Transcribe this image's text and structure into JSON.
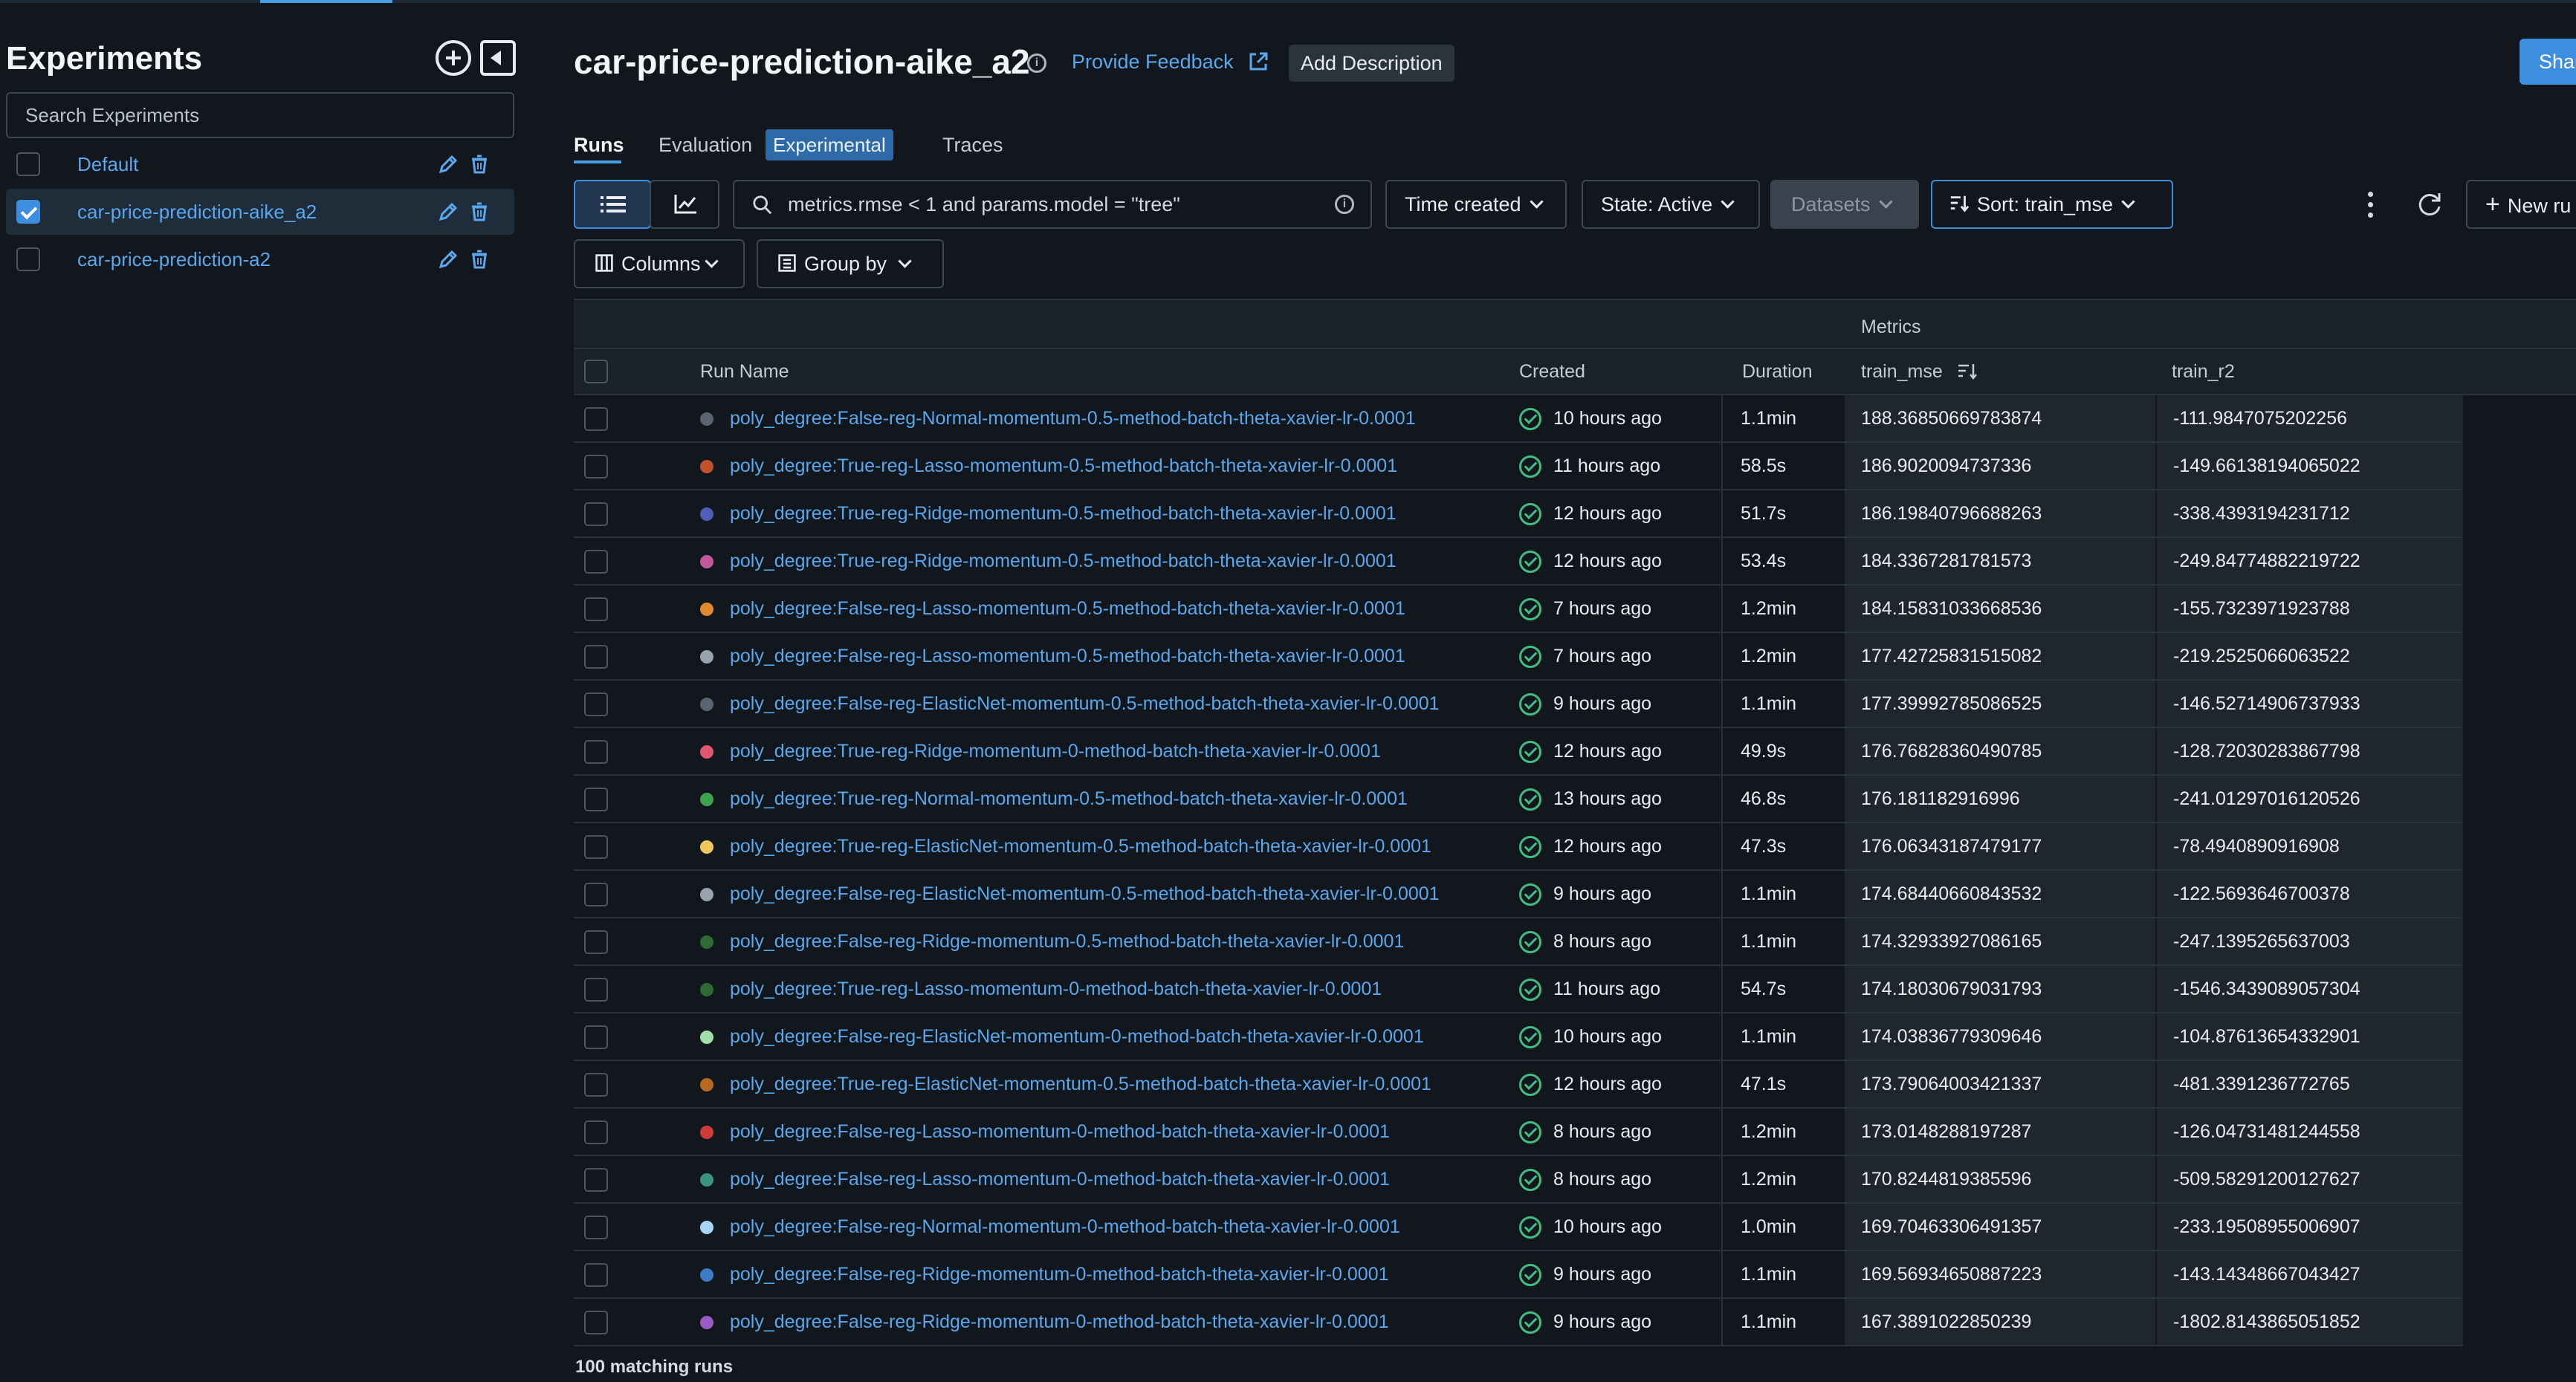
{
  "sidebar": {
    "title": "Experiments",
    "search_placeholder": "Search Experiments",
    "experiments": [
      {
        "name": "Default",
        "checked": false
      },
      {
        "name": "car-price-prediction-aike_a2",
        "checked": true
      },
      {
        "name": "car-price-prediction-a2",
        "checked": false
      }
    ]
  },
  "header": {
    "title": "car-price-prediction-aike_a2",
    "feedback_label": "Provide Feedback",
    "add_description_label": "Add Description",
    "share_label": "Shar"
  },
  "tabs": {
    "runs": "Runs",
    "evaluation": "Evaluation",
    "experimental_badge": "Experimental",
    "traces": "Traces"
  },
  "toolbar": {
    "search_value": "metrics.rmse < 1 and params.model = \"tree\"",
    "time_created": "Time created",
    "state": "State: Active",
    "datasets": "Datasets",
    "sort": "Sort: train_mse",
    "new_run": "New ru",
    "columns": "Columns",
    "group_by": "Group by"
  },
  "table": {
    "group_header": "Metrics",
    "columns": {
      "run_name": "Run Name",
      "created": "Created",
      "duration": "Duration",
      "train_mse": "train_mse",
      "train_r2": "train_r2"
    },
    "rows": [
      {
        "color": "#5b6470",
        "name": "poly_degree:False-reg-Normal-momentum-0.5-method-batch-theta-xavier-lr-0.0001",
        "created": "10 hours ago",
        "duration": "1.1min",
        "train_mse": "188.36850669783874",
        "train_r2": "-111.9847075202256"
      },
      {
        "color": "#c2502a",
        "name": "poly_degree:True-reg-Lasso-momentum-0.5-method-batch-theta-xavier-lr-0.0001",
        "created": "11 hours ago",
        "duration": "58.5s",
        "train_mse": "186.9020094737336",
        "train_r2": "-149.66138194065022"
      },
      {
        "color": "#4f5fb8",
        "name": "poly_degree:True-reg-Ridge-momentum-0.5-method-batch-theta-xavier-lr-0.0001",
        "created": "12 hours ago",
        "duration": "51.7s",
        "train_mse": "186.19840796688263",
        "train_r2": "-338.4393194231712"
      },
      {
        "color": "#c2579b",
        "name": "poly_degree:True-reg-Ridge-momentum-0.5-method-batch-theta-xavier-lr-0.0001",
        "created": "12 hours ago",
        "duration": "53.4s",
        "train_mse": "184.3367281781573",
        "train_r2": "-249.84774882219722"
      },
      {
        "color": "#e08a2e",
        "name": "poly_degree:False-reg-Lasso-momentum-0.5-method-batch-theta-xavier-lr-0.0001",
        "created": "7 hours ago",
        "duration": "1.2min",
        "train_mse": "184.15831033668536",
        "train_r2": "-155.7323971923788"
      },
      {
        "color": "#9aa3ad",
        "name": "poly_degree:False-reg-Lasso-momentum-0.5-method-batch-theta-xavier-lr-0.0001",
        "created": "7 hours ago",
        "duration": "1.2min",
        "train_mse": "177.42725831515082",
        "train_r2": "-219.2525066063522"
      },
      {
        "color": "#5b6470",
        "name": "poly_degree:False-reg-ElasticNet-momentum-0.5-method-batch-theta-xavier-lr-0.0001",
        "created": "9 hours ago",
        "duration": "1.1min",
        "train_mse": "177.39992785086525",
        "train_r2": "-146.52714906737933"
      },
      {
        "color": "#e0566e",
        "name": "poly_degree:True-reg-Ridge-momentum-0-method-batch-theta-xavier-lr-0.0001",
        "created": "12 hours ago",
        "duration": "49.9s",
        "train_mse": "176.76828360490785",
        "train_r2": "-128.72030283867798"
      },
      {
        "color": "#3fa34d",
        "name": "poly_degree:True-reg-Normal-momentum-0.5-method-batch-theta-xavier-lr-0.0001",
        "created": "13 hours ago",
        "duration": "46.8s",
        "train_mse": "176.181182916996",
        "train_r2": "-241.01297016120526"
      },
      {
        "color": "#f0c75e",
        "name": "poly_degree:True-reg-ElasticNet-momentum-0.5-method-batch-theta-xavier-lr-0.0001",
        "created": "12 hours ago",
        "duration": "47.3s",
        "train_mse": "176.06343187479177",
        "train_r2": "-78.4940890916908"
      },
      {
        "color": "#9aa3ad",
        "name": "poly_degree:False-reg-ElasticNet-momentum-0.5-method-batch-theta-xavier-lr-0.0001",
        "created": "9 hours ago",
        "duration": "1.1min",
        "train_mse": "174.68440660843532",
        "train_r2": "-122.5693646700378"
      },
      {
        "color": "#2e6b34",
        "name": "poly_degree:False-reg-Ridge-momentum-0.5-method-batch-theta-xavier-lr-0.0001",
        "created": "8 hours ago",
        "duration": "1.1min",
        "train_mse": "174.32933927086165",
        "train_r2": "-247.1395265637003"
      },
      {
        "color": "#2e6b34",
        "name": "poly_degree:True-reg-Lasso-momentum-0-method-batch-theta-xavier-lr-0.0001",
        "created": "11 hours ago",
        "duration": "54.7s",
        "train_mse": "174.18030679031793",
        "train_r2": "-1546.3439089057304"
      },
      {
        "color": "#9ee0a8",
        "name": "poly_degree:False-reg-ElasticNet-momentum-0-method-batch-theta-xavier-lr-0.0001",
        "created": "10 hours ago",
        "duration": "1.1min",
        "train_mse": "174.03836779309646",
        "train_r2": "-104.87613654332901"
      },
      {
        "color": "#b86a1e",
        "name": "poly_degree:True-reg-ElasticNet-momentum-0.5-method-batch-theta-xavier-lr-0.0001",
        "created": "12 hours ago",
        "duration": "47.1s",
        "train_mse": "173.79064003421337",
        "train_r2": "-481.3391236772765"
      },
      {
        "color": "#d23a3a",
        "name": "poly_degree:False-reg-Lasso-momentum-0-method-batch-theta-xavier-lr-0.0001",
        "created": "8 hours ago",
        "duration": "1.2min",
        "train_mse": "173.0148288197287",
        "train_r2": "-126.04731481244558"
      },
      {
        "color": "#3a9480",
        "name": "poly_degree:False-reg-Lasso-momentum-0-method-batch-theta-xavier-lr-0.0001",
        "created": "8 hours ago",
        "duration": "1.2min",
        "train_mse": "170.8244819385596",
        "train_r2": "-509.58291200127627"
      },
      {
        "color": "#a9d4f5",
        "name": "poly_degree:False-reg-Normal-momentum-0-method-batch-theta-xavier-lr-0.0001",
        "created": "10 hours ago",
        "duration": "1.0min",
        "train_mse": "169.70463306491357",
        "train_r2": "-233.19508955006907"
      },
      {
        "color": "#3c7cc8",
        "name": "poly_degree:False-reg-Ridge-momentum-0-method-batch-theta-xavier-lr-0.0001",
        "created": "9 hours ago",
        "duration": "1.1min",
        "train_mse": "169.56934650887223",
        "train_r2": "-143.14348667043427"
      },
      {
        "color": "#9a5bc4",
        "name": "poly_degree:False-reg-Ridge-momentum-0-method-batch-theta-xavier-lr-0.0001",
        "created": "9 hours ago",
        "duration": "1.1min",
        "train_mse": "167.3891022850239",
        "train_r2": "-1802.8143865051852"
      }
    ]
  },
  "footer": {
    "matching_runs": "100 matching runs"
  }
}
